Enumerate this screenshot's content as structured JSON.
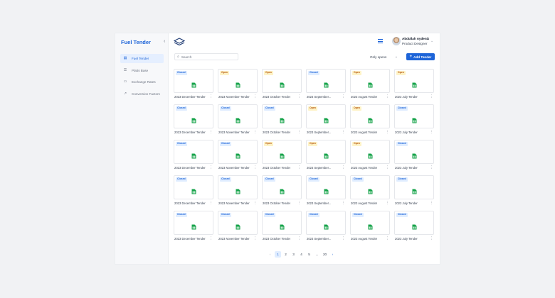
{
  "app": {
    "brand": "Fuel Tender",
    "collapse_icon": "chevron-left-icon"
  },
  "sidebar": {
    "items": [
      {
        "label": "Fuel Tender",
        "icon": "document-icon",
        "active": true
      },
      {
        "label": "Platts Base",
        "icon": "list-icon",
        "active": false
      },
      {
        "label": "Exchange Rates",
        "icon": "money-icon",
        "active": false
      },
      {
        "label": "Conversion Factors",
        "icon": "trend-icon",
        "active": false
      }
    ]
  },
  "header": {
    "user_name": "Abdullah Aydeniz",
    "user_role": "Product Designer"
  },
  "toolbar": {
    "search_placeholder": "Search",
    "filter_value": "Only opens",
    "add_label": "Add Tender"
  },
  "colors": {
    "accent": "#1d64d8",
    "sheet": "#16a34a",
    "open_badge": "#fef3c7",
    "closed_badge": "#e0edff"
  },
  "tenders": [
    {
      "status": "Closed",
      "title": "2023 December Tender"
    },
    {
      "status": "Open",
      "title": "2023 November Tender"
    },
    {
      "status": "Open",
      "title": "2023 October Tender"
    },
    {
      "status": "Closed",
      "title": "2023 September..."
    },
    {
      "status": "Open",
      "title": "2023 August Tender"
    },
    {
      "status": "Open",
      "title": "2023 July Tender"
    },
    {
      "status": "Closed",
      "title": "2023 December Tender"
    },
    {
      "status": "Closed",
      "title": "2023 November Tender"
    },
    {
      "status": "Closed",
      "title": "2023 October Tender"
    },
    {
      "status": "Open",
      "title": "2023 September..."
    },
    {
      "status": "Open",
      "title": "2023 August Tender"
    },
    {
      "status": "Closed",
      "title": "2023 July Tender"
    },
    {
      "status": "Closed",
      "title": "2023 December Tender"
    },
    {
      "status": "Closed",
      "title": "2023 November Tender"
    },
    {
      "status": "Open",
      "title": "2023 October Tender"
    },
    {
      "status": "Open",
      "title": "2023 September..."
    },
    {
      "status": "Open",
      "title": "2023 August Tender"
    },
    {
      "status": "Closed",
      "title": "2023 July Tender"
    },
    {
      "status": "Closed",
      "title": "2023 December Tender"
    },
    {
      "status": "Closed",
      "title": "2023 November Tender"
    },
    {
      "status": "Closed",
      "title": "2023 October Tender"
    },
    {
      "status": "Closed",
      "title": "2023 September..."
    },
    {
      "status": "Closed",
      "title": "2023 August Tender"
    },
    {
      "status": "Closed",
      "title": "2023 July Tender"
    },
    {
      "status": "Closed",
      "title": "2023 December Tender"
    },
    {
      "status": "Closed",
      "title": "2023 November Tender"
    },
    {
      "status": "Closed",
      "title": "2023 October Tender"
    },
    {
      "status": "Closed",
      "title": "2023 September..."
    },
    {
      "status": "Closed",
      "title": "2023 August Tender"
    },
    {
      "status": "Closed",
      "title": "2023 July Tender"
    }
  ],
  "pagination": {
    "prev_icon": "chevron-left-icon",
    "next_icon": "chevron-right-icon",
    "pages": [
      "1",
      "2",
      "3",
      "4",
      "5",
      "...",
      "20"
    ],
    "current": "1"
  }
}
